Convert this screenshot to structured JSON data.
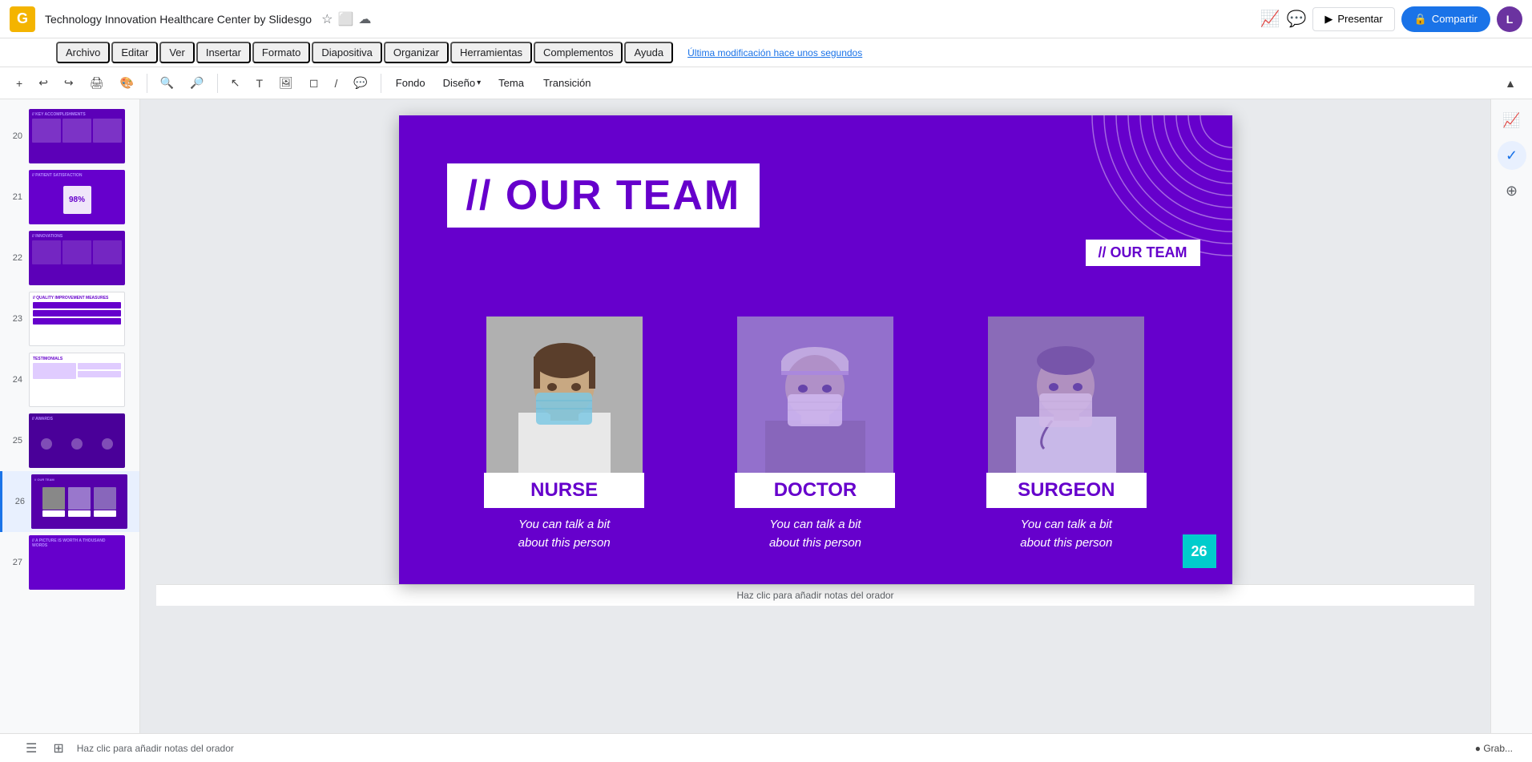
{
  "app": {
    "logo": "G",
    "title": "Technology Innovation Healthcare Center by Slidesgo",
    "last_saved": "Última modificación hace unos segundos",
    "present_label": "Presentar",
    "share_label": "Compartir",
    "avatar_initials": "L"
  },
  "menu": {
    "items": [
      "Archivo",
      "Editar",
      "Ver",
      "Insertar",
      "Formato",
      "Diapositiva",
      "Organizar",
      "Herramientas",
      "Complementos",
      "Ayuda"
    ]
  },
  "toolbar": {
    "fondo_label": "Fondo",
    "diseno_label": "Diseño",
    "tema_label": "Tema",
    "transicion_label": "Transición"
  },
  "sidebar": {
    "slides": [
      {
        "num": "20",
        "type": "purple"
      },
      {
        "num": "21",
        "type": "purple"
      },
      {
        "num": "22",
        "type": "purple"
      },
      {
        "num": "23",
        "type": "white"
      },
      {
        "num": "24",
        "type": "white"
      },
      {
        "num": "25",
        "type": "dark-purple"
      },
      {
        "num": "26",
        "type": "team",
        "active": true
      },
      {
        "num": "27",
        "type": "purple"
      }
    ]
  },
  "slide": {
    "background_color": "#6600cc",
    "title": "// OUR TEAM",
    "top_right_label": "// OUR TEAM",
    "team_members": [
      {
        "id": "nurse",
        "title": "NURSE",
        "description": "You can talk a bit\nabout this person",
        "photo_color": "#a0a0a0"
      },
      {
        "id": "doctor",
        "title": "DOCTOR",
        "description": "You can talk a bit\nabout this person",
        "photo_color": "#9370cc"
      },
      {
        "id": "surgeon",
        "title": "SURGEON",
        "description": "You can talk a bit\nabout this person",
        "photo_color": "#8a6bb8"
      }
    ],
    "page_number": "26"
  },
  "notes": {
    "placeholder": "Haz clic para añadir notas del orador"
  },
  "right_panel": {
    "icons": [
      "📊",
      "💬",
      "⊕"
    ]
  }
}
